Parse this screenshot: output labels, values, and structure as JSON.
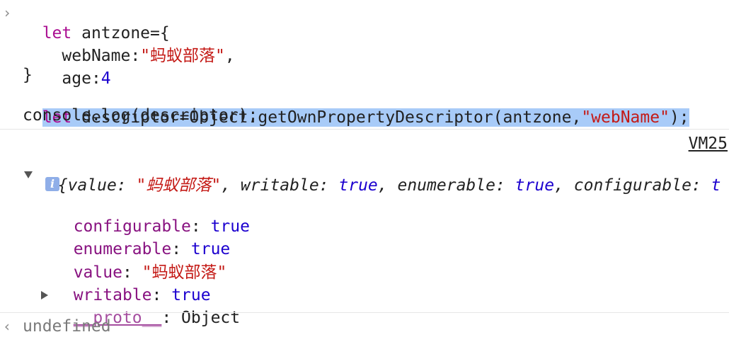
{
  "input": {
    "prompt_glyph": "›",
    "l1": {
      "kw": "let",
      "rest": " antzone={"
    },
    "l2": {
      "key": "  webName:",
      "val": "\"蚂蚁部落\"",
      "tail": ","
    },
    "l3": {
      "key": "  age:",
      "val": "4"
    },
    "l4": "}",
    "l5": {
      "kw": "let",
      "mid": " descriptor=Object.getOwnPropertyDescriptor(antzone,",
      "str": "\"webName\"",
      "tail": ");"
    },
    "l6": "console.log(descriptor);"
  },
  "output": {
    "source_link": "VM25",
    "summary": {
      "open": "{",
      "k1": "value: ",
      "v1": "\"蚂蚁部落\"",
      "c1": ", ",
      "k2": "writable: ",
      "v2": "true",
      "c2": ", ",
      "k3": "enumerable: ",
      "v3": "true",
      "c3": ", ",
      "k4": "configurable: ",
      "v4": "t"
    },
    "info_glyph": "i",
    "props": [
      {
        "key": "configurable",
        "sep": ": ",
        "val": "true",
        "type": "bool"
      },
      {
        "key": "enumerable",
        "sep": ": ",
        "val": "true",
        "type": "bool"
      },
      {
        "key": "value",
        "sep": ": ",
        "val": "\"蚂蚁部落\"",
        "type": "str"
      },
      {
        "key": "writable",
        "sep": ": ",
        "val": "true",
        "type": "bool"
      }
    ],
    "proto": {
      "key": "__proto__",
      "sep": ": ",
      "val": "Object"
    }
  },
  "result": {
    "prompt_glyph": "‹",
    "text": "undefined"
  },
  "colors": {
    "selection": "#a8cbf8",
    "keyword": "#aa0d91",
    "string": "#c41a16",
    "number": "#1c00cf",
    "property": "#881280"
  }
}
